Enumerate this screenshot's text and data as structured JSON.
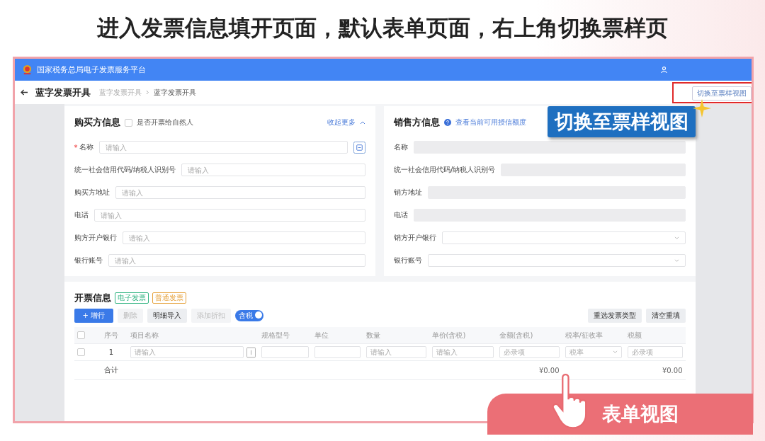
{
  "title": "进入发票信息填开页面，默认表单页面，右上角切换票样页",
  "header": {
    "platform": "国家税务总局电子发票服务平台"
  },
  "nav": {
    "page_title": "蓝字发票开具",
    "breadcrumb": [
      "蓝字发票开具",
      "蓝字发票开具"
    ],
    "switch_button": "切换至票样视图"
  },
  "buyer": {
    "heading": "购买方信息",
    "natural_person": {
      "label": "是否开票给自然人",
      "checked": false
    },
    "collapse_link": "收起更多",
    "fields": [
      {
        "label": "名称",
        "required_mark": "*",
        "placeholder": "请输入",
        "lookup": true
      },
      {
        "label": "统一社会信用代码/纳税人识别号",
        "placeholder": "请输入",
        "lookup": false
      },
      {
        "label": "购买方地址",
        "placeholder": "请输入",
        "lookup": false
      },
      {
        "label": "电话",
        "placeholder": "请输入",
        "lookup": false
      },
      {
        "label": "购方开户银行",
        "placeholder": "请输入",
        "lookup": false
      },
      {
        "label": "银行账号",
        "placeholder": "请输入",
        "lookup": false
      }
    ]
  },
  "seller": {
    "heading": "销售方信息",
    "link": "查看当前可用授信额度",
    "fields": [
      {
        "label": "名称",
        "kind": "disabled"
      },
      {
        "label": "统一社会信用代码/纳税人识别号",
        "kind": "disabled"
      },
      {
        "label": "销方地址",
        "kind": "disabled"
      },
      {
        "label": "电话",
        "kind": "disabled"
      },
      {
        "label": "销方开户银行",
        "kind": "select"
      },
      {
        "label": "银行账号",
        "kind": "select"
      }
    ]
  },
  "invoice": {
    "heading": "开票信息",
    "tags": [
      {
        "label": "电子发票",
        "color": "#2fb380"
      },
      {
        "label": "普通发票",
        "color": "#e6a23c"
      }
    ],
    "buttons": [
      {
        "label": "+ 增行",
        "kind": "primary"
      },
      {
        "label": "删除",
        "kind": "disabled"
      },
      {
        "label": "明细导入",
        "kind": "default"
      },
      {
        "label": "添加折扣",
        "kind": "disabled"
      }
    ],
    "tax_toggle": {
      "label": "含税",
      "on": true
    },
    "right_buttons": [
      "重选发票类型",
      "清空重填"
    ],
    "header_checked": false,
    "columns": [
      "序号",
      "项目名称",
      "规格型号",
      "单位",
      "数量",
      "单价(含税)",
      "金额(含税)",
      "税率/征收率",
      "税额"
    ],
    "rows": [
      {
        "checked": false,
        "cells": [
          {
            "kind": "text",
            "value": "1"
          },
          {
            "kind": "picker",
            "placeholder": "请输入"
          },
          {
            "kind": "input"
          },
          {
            "kind": "input"
          },
          {
            "kind": "input",
            "placeholder": "请输入"
          },
          {
            "kind": "input",
            "placeholder": "请输入"
          },
          {
            "kind": "input",
            "placeholder": "必录项"
          },
          {
            "kind": "select",
            "placeholder": "税率"
          },
          {
            "kind": "input",
            "placeholder": "必录项"
          }
        ]
      }
    ],
    "total": {
      "label": "合计",
      "amount": "¥0.00",
      "tax": "¥0.00"
    }
  },
  "callouts": [
    {
      "kind": "tooltip",
      "text": "切换至票样视图"
    },
    {
      "kind": "banner",
      "text": "表单视图"
    }
  ]
}
